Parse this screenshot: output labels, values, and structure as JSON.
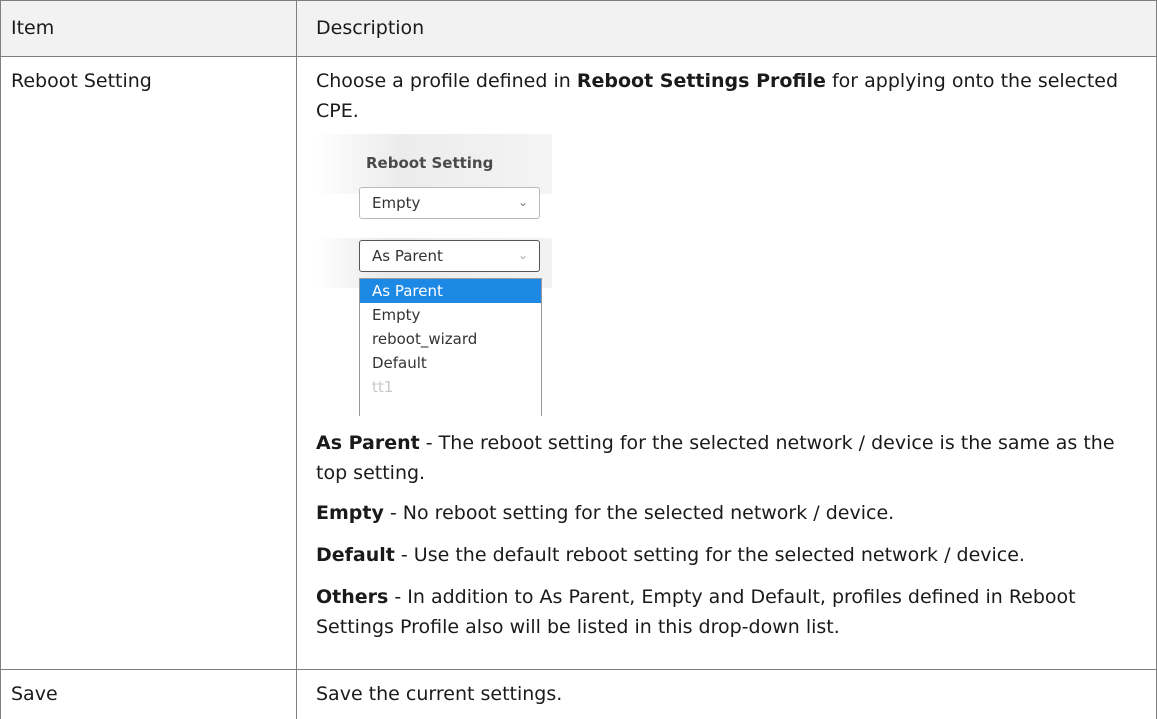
{
  "header": {
    "col1": "Item",
    "col2": "Description"
  },
  "rows": [
    {
      "item": "Reboot Setting",
      "intro_pre": "Choose a profile defined in ",
      "intro_bold": "Reboot Settings Profile",
      "intro_post": " for applying onto the selected CPE.",
      "screenshot": {
        "title": "Reboot Setting",
        "select1_value": "Empty",
        "select2_value": "As Parent",
        "options": [
          "As Parent",
          "Empty",
          "reboot_wizard",
          "Default",
          "tt1"
        ]
      },
      "defs": [
        {
          "term": "As Parent",
          "text": " - The reboot setting for the selected network / device is the same as the top setting."
        },
        {
          "term": "Empty",
          "text": " - No reboot setting for the selected network / device."
        },
        {
          "term": "Default",
          "text": " - Use the default reboot setting for the selected network / device."
        },
        {
          "term": "Others",
          "text": " - In addition to As Parent, Empty and Default, profiles defined in Reboot Settings Profile also will be listed in this drop-down list."
        }
      ]
    },
    {
      "item": "Save",
      "description": "Save the current settings."
    }
  ],
  "icons": {
    "select_arrow": "chevron-down-icon"
  }
}
